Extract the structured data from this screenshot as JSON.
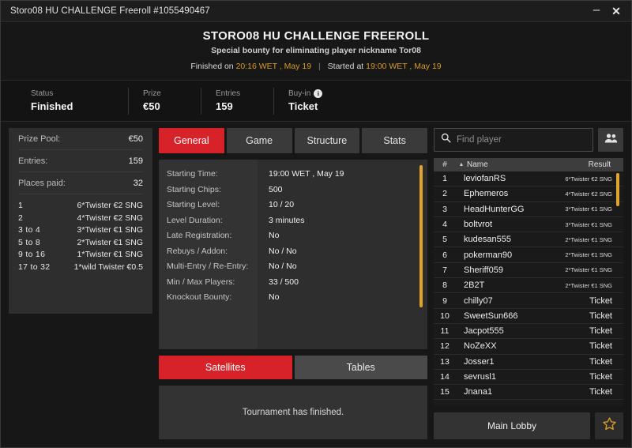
{
  "titlebar": {
    "text": "Storo08 HU CHALLENGE Freeroll #1055490467",
    "minimize": "–",
    "close": "✕"
  },
  "header": {
    "title": "STORO08 HU CHALLENGE FREEROLL",
    "subtitle": "Special bounty for eliminating player nickname Tor08",
    "finished_prefix": "Finished on",
    "finished_time": "20:16 WET , May 19",
    "separator": "|",
    "started_prefix": "Started at",
    "started_time": "19:00 WET , May 19"
  },
  "status": [
    {
      "label": "Status",
      "value": "Finished",
      "info": false
    },
    {
      "label": "Prize",
      "value": "€50",
      "info": false
    },
    {
      "label": "Entries",
      "value": "159",
      "info": false
    },
    {
      "label": "Buy-in",
      "value": "Ticket",
      "info": true,
      "info_glyph": "i"
    }
  ],
  "prize_panel": {
    "rows": [
      {
        "key": "Prize Pool:",
        "value": "€50"
      },
      {
        "key": "Entries:",
        "value": "159"
      },
      {
        "key": "Places paid:",
        "value": "32"
      }
    ],
    "payouts": [
      {
        "place": "1",
        "prize": "6*Twister €2 SNG"
      },
      {
        "place": "2",
        "prize": "4*Twister €2 SNG"
      },
      {
        "place": "3  to  4",
        "prize": "3*Twister €1 SNG"
      },
      {
        "place": "5  to  8",
        "prize": "2*Twister €1 SNG"
      },
      {
        "place": "9  to  16",
        "prize": "1*Twister €1 SNG"
      },
      {
        "place": "17  to  32",
        "prize": "1*wild Twister €0.5"
      }
    ]
  },
  "tabs": [
    {
      "label": "General",
      "active": true
    },
    {
      "label": "Game",
      "active": false
    },
    {
      "label": "Structure",
      "active": false
    },
    {
      "label": "Stats",
      "active": false
    }
  ],
  "general_info": [
    {
      "label": "Starting Time:",
      "value": "19:00 WET , May 19"
    },
    {
      "label": "Starting Chips:",
      "value": "500"
    },
    {
      "label": "Starting Level:",
      "value": "10 / 20"
    },
    {
      "label": "Level Duration:",
      "value": "3 minutes"
    },
    {
      "label": "Late Registration:",
      "value": "No"
    },
    {
      "label": "Rebuys / Addon:",
      "value": "No / No"
    },
    {
      "label": "Multi-Entry / Re-Entry:",
      "value": "No / No"
    },
    {
      "label": "Min / Max Players:",
      "value": "33 / 500"
    },
    {
      "label": "Knockout Bounty:",
      "value": "No"
    }
  ],
  "sub_tabs": [
    {
      "label": "Satellites",
      "active": true
    },
    {
      "label": "Tables",
      "active": false
    }
  ],
  "sat_message": "Tournament has finished.",
  "search": {
    "placeholder": "Find player",
    "value": "",
    "icon": "search-icon",
    "people_icon": "people-icon"
  },
  "players_header": {
    "num": "#",
    "sort": "▲",
    "name": "Name",
    "result": "Result"
  },
  "players": [
    {
      "num": "1",
      "name": "leviofanRS",
      "result": "6*Twister €2 SNG",
      "small": true
    },
    {
      "num": "2",
      "name": "Ephemeros",
      "result": "4*Twister €2 SNG",
      "small": true
    },
    {
      "num": "3",
      "name": "HeadHunterGG",
      "result": "3*Twister €1 SNG",
      "small": true
    },
    {
      "num": "4",
      "name": "boltvrot",
      "result": "3*Twister €1 SNG",
      "small": true
    },
    {
      "num": "5",
      "name": "kudesan555",
      "result": "2*Twister €1 SNG",
      "small": true
    },
    {
      "num": "6",
      "name": "pokerman90",
      "result": "2*Twister €1 SNG",
      "small": true
    },
    {
      "num": "7",
      "name": "Sheriff059",
      "result": "2*Twister €1 SNG",
      "small": true
    },
    {
      "num": "8",
      "name": "2B2T",
      "result": "2*Twister €1 SNG",
      "small": true
    },
    {
      "num": "9",
      "name": "chilly07",
      "result": "Ticket",
      "small": false
    },
    {
      "num": "10",
      "name": "SweetSun666",
      "result": "Ticket",
      "small": false
    },
    {
      "num": "11",
      "name": "Jacpot555",
      "result": "Ticket",
      "small": false
    },
    {
      "num": "12",
      "name": "NoZeXX",
      "result": "Ticket",
      "small": false
    },
    {
      "num": "13",
      "name": "Josser1",
      "result": "Ticket",
      "small": false
    },
    {
      "num": "14",
      "name": "sevrusl1",
      "result": "Ticket",
      "small": false
    },
    {
      "num": "15",
      "name": "Jnana1",
      "result": "Ticket",
      "small": false
    }
  ],
  "footer": {
    "main_lobby": "Main Lobby",
    "star_icon": "star-icon"
  },
  "colors": {
    "accent_red": "#d8222a",
    "gold": "#d79a28",
    "scrollbar": "#e0a52a",
    "panel": "#2e2e2e",
    "window": "#171717"
  }
}
